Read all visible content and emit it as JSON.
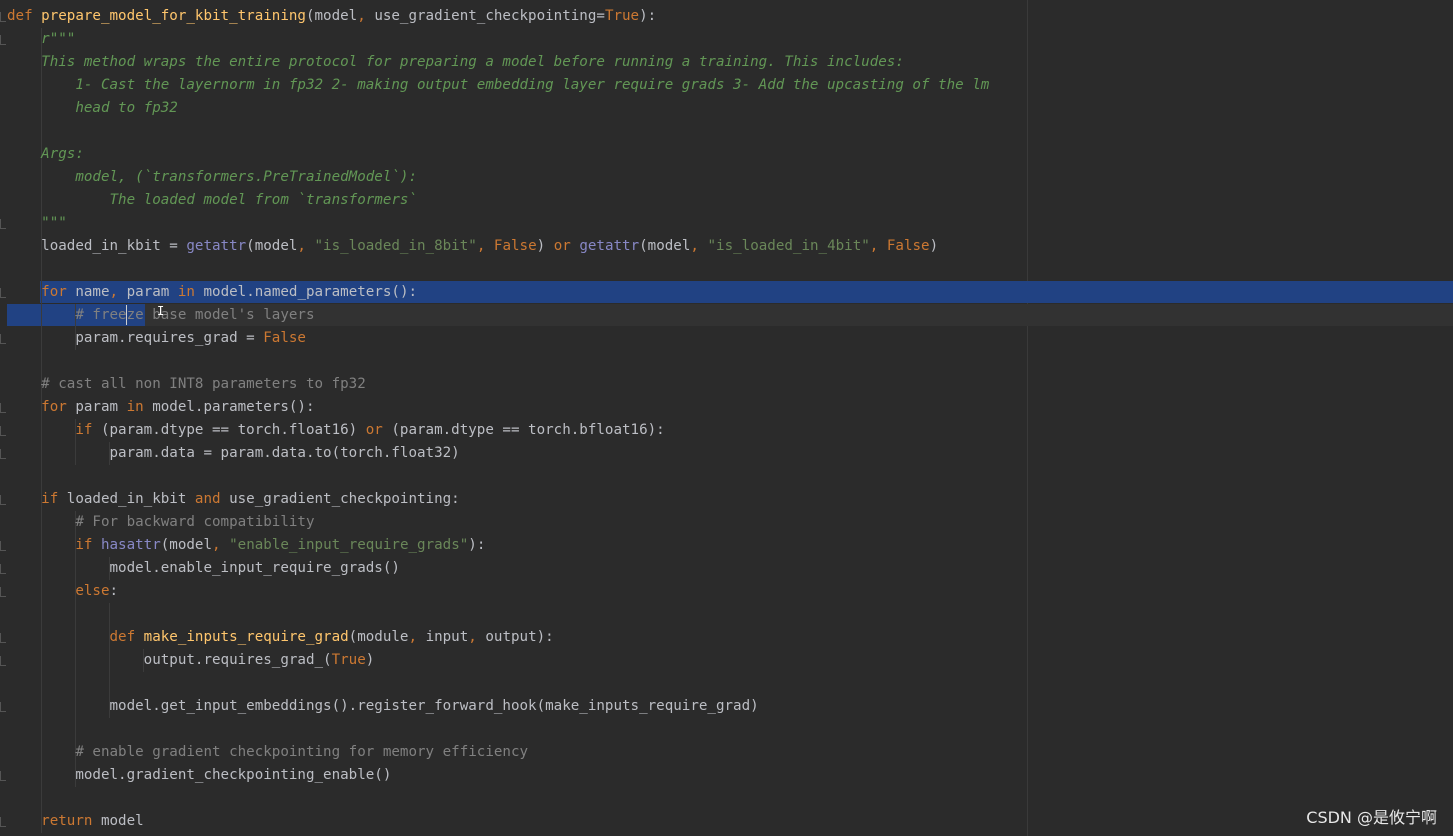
{
  "code_lines": [
    {
      "tokens": [
        {
          "t": "def ",
          "c": "kw"
        },
        {
          "t": "prepare_model_for_kbit_training",
          "c": "fn"
        },
        {
          "t": "(model",
          "c": "plain"
        },
        {
          "t": ", ",
          "c": "kw"
        },
        {
          "t": "use_gradient_checkpointing=",
          "c": "plain"
        },
        {
          "t": "True",
          "c": "kw"
        },
        {
          "t": "):",
          "c": "plain"
        }
      ]
    },
    {
      "tokens": [
        {
          "t": "    r\"\"\"",
          "c": "doc"
        }
      ]
    },
    {
      "tokens": [
        {
          "t": "    This method wraps the entire protocol for preparing a model before running a training. This includes:",
          "c": "doc"
        }
      ]
    },
    {
      "tokens": [
        {
          "t": "        1- Cast the layernorm in fp32 2- making output embedding layer require grads 3- Add the upcasting of the lm",
          "c": "doc"
        }
      ]
    },
    {
      "tokens": [
        {
          "t": "        head to fp32",
          "c": "doc"
        }
      ]
    },
    {
      "tokens": []
    },
    {
      "tokens": [
        {
          "t": "    Args:",
          "c": "doc"
        }
      ]
    },
    {
      "tokens": [
        {
          "t": "        model, (`transformers.PreTrainedModel`):",
          "c": "doc"
        }
      ]
    },
    {
      "tokens": [
        {
          "t": "            The loaded model from `transformers`",
          "c": "doc"
        }
      ]
    },
    {
      "tokens": [
        {
          "t": "    \"\"\"",
          "c": "doc"
        }
      ]
    },
    {
      "tokens": [
        {
          "t": "    loaded_in_kbit = ",
          "c": "plain"
        },
        {
          "t": "getattr",
          "c": "bi"
        },
        {
          "t": "(model",
          "c": "plain"
        },
        {
          "t": ", ",
          "c": "kw"
        },
        {
          "t": "\"is_loaded_in_8bit\"",
          "c": "str"
        },
        {
          "t": ", ",
          "c": "kw"
        },
        {
          "t": "False",
          "c": "kw"
        },
        {
          "t": ") ",
          "c": "plain"
        },
        {
          "t": "or ",
          "c": "kw"
        },
        {
          "t": "getattr",
          "c": "bi"
        },
        {
          "t": "(model",
          "c": "plain"
        },
        {
          "t": ", ",
          "c": "kw"
        },
        {
          "t": "\"is_loaded_in_4bit\"",
          "c": "str"
        },
        {
          "t": ", ",
          "c": "kw"
        },
        {
          "t": "False",
          "c": "kw"
        },
        {
          "t": ")",
          "c": "plain"
        }
      ]
    },
    {
      "tokens": []
    },
    {
      "tokens": [
        {
          "t": "    for ",
          "c": "kw"
        },
        {
          "t": "name",
          "c": "plain"
        },
        {
          "t": ", ",
          "c": "kw"
        },
        {
          "t": "param ",
          "c": "plain"
        },
        {
          "t": "in ",
          "c": "kw"
        },
        {
          "t": "model.named_parameters():",
          "c": "plain"
        }
      ]
    },
    {
      "tokens": [
        {
          "t": "        # freeze base model's layers",
          "c": "cmt"
        }
      ]
    },
    {
      "tokens": [
        {
          "t": "        param.requires_grad = ",
          "c": "plain"
        },
        {
          "t": "False",
          "c": "kw"
        }
      ]
    },
    {
      "tokens": []
    },
    {
      "tokens": [
        {
          "t": "    # cast all non INT8 parameters to fp32",
          "c": "cmt"
        }
      ]
    },
    {
      "tokens": [
        {
          "t": "    for ",
          "c": "kw"
        },
        {
          "t": "param ",
          "c": "plain"
        },
        {
          "t": "in ",
          "c": "kw"
        },
        {
          "t": "model.parameters():",
          "c": "plain"
        }
      ]
    },
    {
      "tokens": [
        {
          "t": "        if ",
          "c": "kw"
        },
        {
          "t": "(param.dtype == torch.float16) ",
          "c": "plain"
        },
        {
          "t": "or ",
          "c": "kw"
        },
        {
          "t": "(param.dtype == torch.bfloat16):",
          "c": "plain"
        }
      ]
    },
    {
      "tokens": [
        {
          "t": "            param.data = param.data.to(torch.float32)",
          "c": "plain"
        }
      ]
    },
    {
      "tokens": []
    },
    {
      "tokens": [
        {
          "t": "    if ",
          "c": "kw"
        },
        {
          "t": "loaded_in_kbit ",
          "c": "plain"
        },
        {
          "t": "and ",
          "c": "kw"
        },
        {
          "t": "use_gradient_checkpointing:",
          "c": "plain"
        }
      ]
    },
    {
      "tokens": [
        {
          "t": "        # For backward compatibility",
          "c": "cmt"
        }
      ]
    },
    {
      "tokens": [
        {
          "t": "        if ",
          "c": "kw"
        },
        {
          "t": "hasattr",
          "c": "bi"
        },
        {
          "t": "(model",
          "c": "plain"
        },
        {
          "t": ", ",
          "c": "kw"
        },
        {
          "t": "\"enable_input_require_grads\"",
          "c": "str"
        },
        {
          "t": "):",
          "c": "plain"
        }
      ]
    },
    {
      "tokens": [
        {
          "t": "            model.enable_input_require_grads()",
          "c": "plain"
        }
      ]
    },
    {
      "tokens": [
        {
          "t": "        else",
          "c": "kw"
        },
        {
          "t": ":",
          "c": "plain"
        }
      ]
    },
    {
      "tokens": []
    },
    {
      "tokens": [
        {
          "t": "            def ",
          "c": "kw"
        },
        {
          "t": "make_inputs_require_grad",
          "c": "fn"
        },
        {
          "t": "(module",
          "c": "plain"
        },
        {
          "t": ", ",
          "c": "kw"
        },
        {
          "t": "input",
          "c": "plain"
        },
        {
          "t": ", ",
          "c": "kw"
        },
        {
          "t": "output):",
          "c": "plain"
        }
      ]
    },
    {
      "tokens": [
        {
          "t": "                output.requires_grad_(",
          "c": "plain"
        },
        {
          "t": "True",
          "c": "kw"
        },
        {
          "t": ")",
          "c": "plain"
        }
      ]
    },
    {
      "tokens": []
    },
    {
      "tokens": [
        {
          "t": "            model.get_input_embeddings().register_forward_hook(make_inputs_require_grad)",
          "c": "plain"
        }
      ]
    },
    {
      "tokens": []
    },
    {
      "tokens": [
        {
          "t": "        # enable gradient checkpointing for memory efficiency",
          "c": "cmt"
        }
      ]
    },
    {
      "tokens": [
        {
          "t": "        model.gradient_checkpointing_enable()",
          "c": "plain"
        }
      ]
    },
    {
      "tokens": []
    },
    {
      "tokens": [
        {
          "t": "    return ",
          "c": "kw"
        },
        {
          "t": "model",
          "c": "plain"
        }
      ]
    }
  ],
  "watermark": "CSDN @是攸宁啊",
  "colors": {
    "background": "#2b2b2b",
    "keyword": "#cc7832",
    "function": "#ffc66d",
    "builtin": "#8888c6",
    "string": "#6a8759",
    "docstring": "#629755",
    "comment": "#808080",
    "selection": "#214283"
  }
}
